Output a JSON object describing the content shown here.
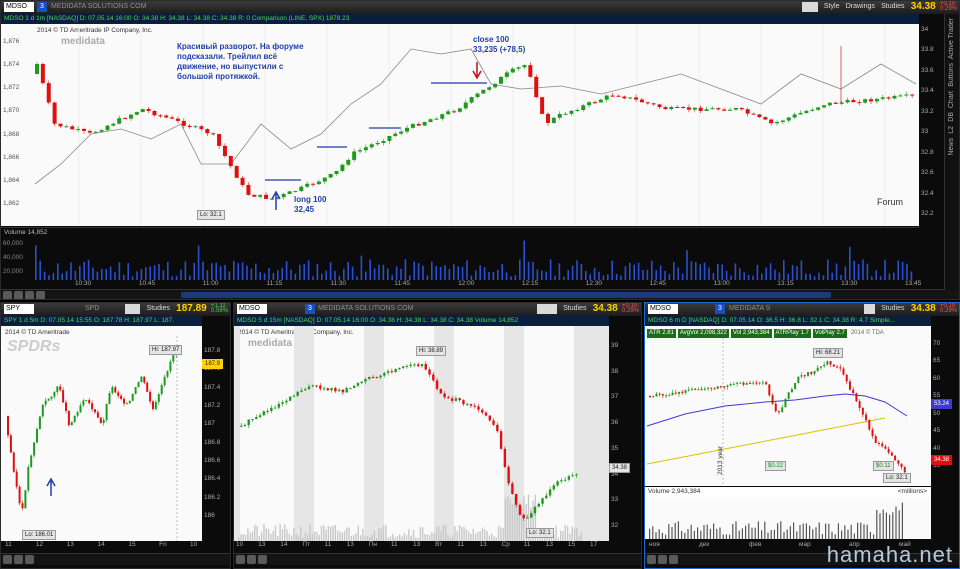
{
  "main": {
    "symbol": "MDSO",
    "group": "3",
    "company": "MEDIDATA SOLUTIONS COM",
    "interval": "1m",
    "style": "Style",
    "drawings": "Drawings",
    "studies": "Studies",
    "price": "34.38",
    "change": "+0.10",
    "change2": "0.29%",
    "header": "MDSO 1 d 1m [NASDAQ]  D: 07.05.14 16:00  O: 34.38  H: 34.38  L: 34.38  C: 34.38  R: 0   Comparison (LINE, SPX)  1878.23",
    "copyright": "2014 © TD Ameritrade IP Company, Inc.",
    "brand": "medidata",
    "annotation_top": "Красивый разворот. На форуме\nподсказали. Трейлил всё\nдвижение, но выпустили с\nбольшой протяжкой.",
    "annotation_close": "close 100\n33,235 (+78,5)",
    "annotation_long": "long 100\n32,45",
    "forum": "Forum",
    "low_tag": "Lo: 32.1",
    "volume_header": "Volume  14,852",
    "y_labels_left": [
      "1,876",
      "1,874",
      "1,872",
      "1,870",
      "1,868",
      "1,866",
      "1,864",
      "1,862"
    ],
    "y_labels_right": [
      "34",
      "33.8",
      "33.6",
      "33.4",
      "33.2",
      "33",
      "32.8",
      "32.6",
      "32.4",
      "32.2"
    ],
    "vol_labels": [
      "60,000",
      "40,000",
      "20,000"
    ],
    "x_labels": [
      "10:30",
      "10:45",
      "11:00",
      "11:15",
      "11:30",
      "11:45",
      "12:00",
      "12:15",
      "12:30",
      "12:45",
      "13:00",
      "13:15",
      "13:30",
      "13:45"
    ],
    "side_tabs": [
      "Active Trader",
      "Buttons",
      "Chart",
      "DB",
      "L2",
      "News"
    ]
  },
  "spy": {
    "symbol": "SPY",
    "company": "SPD",
    "interval": "5m",
    "studies": "Studies",
    "price": "187.89",
    "change": "+1.11",
    "change2": "0.59%",
    "header": "SPY 1 d 5m  D: 07.05.14 15:55  O: 187.78  H: 187.97  L: 187.",
    "copyright": "2014 © TD Ameritrade",
    "brand": "SPDRs",
    "hi_tag": "Hi: 187.97",
    "lo_tag": "Lo: 186.01",
    "last_tag": "187.9",
    "y_labels": [
      "187.8",
      "187.6",
      "187.4",
      "187.2",
      "187",
      "186.8",
      "186.6",
      "186.4",
      "186.2",
      "186"
    ],
    "x_labels": [
      "11",
      "12",
      "13",
      "14",
      "15",
      "Fri",
      "10"
    ]
  },
  "mid": {
    "symbol": "MDSO",
    "group": "3",
    "company": "MEDIDATA SOLUTIONS COM",
    "interval": "15m",
    "studies": "Studies",
    "price": "34.38",
    "change": "+0.10",
    "change2": "0.29%",
    "header": "MDSO 5 d 15m [NASDAQ]  D: 07.05.14 16:00  O: 34.38  H: 34.38  L: 34.38  C: 34.38  Volume  14,852",
    "copyright": "2014 © TD Ameritrade IP Company, Inc.",
    "brand": "medidata",
    "hi_tag": "Hi: 38.89",
    "lo_tag": "Lo: 32.1",
    "last_tag": "34.38",
    "y_labels": [
      "39",
      "38",
      "37",
      "36",
      "35",
      "34",
      "33",
      "32"
    ],
    "x_labels": [
      "10",
      "13",
      "14",
      "Пт",
      "11",
      "13",
      "Пн",
      "11",
      "13",
      "Вт",
      "11",
      "13",
      "Ср",
      "11",
      "13",
      "15",
      "17"
    ]
  },
  "daily": {
    "symbol": "MDSO",
    "group": "3",
    "company": "MEDIDATA S",
    "interval": "D",
    "studies": "Studies",
    "price": "34.38",
    "change": "+0.10",
    "change2": "0.29%",
    "header": "MDSO 6 m D [NASDAQ]  D: 07.05.14  O: 36.5  H: 36.8  L: 32.1  C: 34.38  R: 4.7  Simple...",
    "indicators": [
      "ATR 2.81",
      "AvgVol 2,098,322",
      "Vol 2,943,384",
      "ATRPlay 1.7",
      "VolPlay 2.7",
      "2014 © TDA"
    ],
    "hi_tag": "Hi: 68.21",
    "lo_tag": "Lo: 32.1",
    "ma_tag": "53.24",
    "last_tag": "34.38",
    "year_label": "2013 year",
    "volume_header": "Volume  2,943,384",
    "volume_unit": "<millions>",
    "y_labels": [
      "70",
      "65",
      "60",
      "55",
      "50",
      "45",
      "40",
      "35"
    ],
    "x_labels": [
      "ноя",
      "дек",
      "фев",
      "мар",
      "апр",
      "май"
    ],
    "event_tags": [
      "$0.22",
      "$0.11"
    ]
  },
  "watermark": "hamaha.net",
  "colors": {
    "up": "#1e9b1e",
    "down": "#e01010",
    "annotation": "#1f3fa8",
    "accent": "#1a4fbf",
    "price": "#ffd200"
  }
}
